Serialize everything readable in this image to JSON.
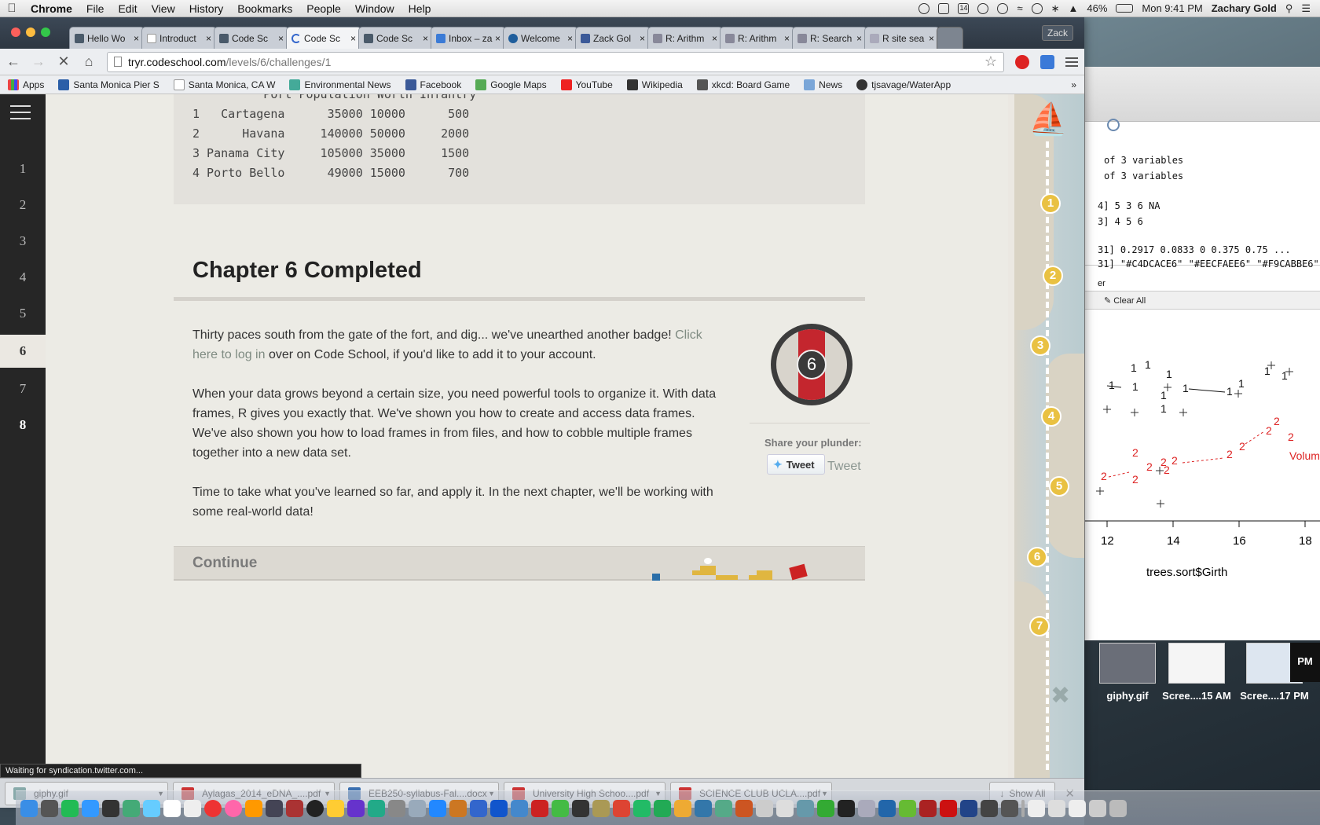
{
  "menubar": {
    "app": "Chrome",
    "items": [
      "File",
      "Edit",
      "View",
      "History",
      "Bookmarks",
      "People",
      "Window",
      "Help"
    ],
    "battery": "46%",
    "calendar_day": "14",
    "clock": "Mon 9:41 PM",
    "user": "Zachary Gold"
  },
  "browser": {
    "profile": "Zack",
    "tabs": [
      {
        "label": "Hello Wo"
      },
      {
        "label": "Introduct"
      },
      {
        "label": "Code Sc"
      },
      {
        "label": "Code Sc"
      },
      {
        "label": "Code Sc"
      },
      {
        "label": "Inbox – za"
      },
      {
        "label": "Welcome"
      },
      {
        "label": "Zack Gol"
      },
      {
        "label": "R: Arithm"
      },
      {
        "label": "R: Arithm"
      },
      {
        "label": "R: Search"
      },
      {
        "label": "R site sea"
      }
    ],
    "url_host": "tryr.codeschool.com",
    "url_path": "/levels/6/challenges/1",
    "bookmarks": [
      "Apps",
      "Santa Monica Pier S",
      "Santa Monica, CA W",
      "Environmental News",
      "Facebook",
      "Google Maps",
      "YouTube",
      "Wikipedia",
      "xkcd: Board Game",
      "News",
      "tjsavage/WaterApp"
    ]
  },
  "levels": [
    "1",
    "2",
    "3",
    "4",
    "5",
    "6",
    "7",
    "8"
  ],
  "code_output": [
    "          Port Population Worth Infantry",
    "1   Cartagena      35000 10000      500",
    "2      Havana     140000 50000     2000",
    "3 Panama City     105000 35000     1500",
    "4 Porto Bello      49000 15000      700"
  ],
  "chapter": {
    "title": "Chapter 6 Completed",
    "p1_before": "Thirty paces south from the gate of the fort, and dig... we've unearthed another badge! ",
    "p1_link": "Click here to log in",
    "p1_after": " over on Code School, if you'd like to add it to your account.",
    "p2": "When your data grows beyond a certain size, you need powerful tools to organize it. With data frames, R gives you exactly that. We've shown you how to create and access data frames. We've also shown you how to load frames in from files, and how to cobble multiple frames together into a new data set.",
    "p3": "Time to take what you've learned so far, and apply it. In the next chapter, we'll be working with some real-world data!",
    "badge_number": "6",
    "share_label": "Share your plunder:",
    "tweet_button": "Tweet",
    "tweet_text": "Tweet",
    "continue": "Continue"
  },
  "map_pins": [
    "1",
    "2",
    "3",
    "4",
    "5",
    "6",
    "7"
  ],
  "status": "Waiting for syndication.twitter.com...",
  "downloads": [
    {
      "name": "giphy.gif"
    },
    {
      "name": "Aylagas_2014_eDNA_....pdf"
    },
    {
      "name": "EEB250-syllabus-Fal....docx"
    },
    {
      "name": "University High Schoo....pdf"
    },
    {
      "name": "SCIENCE CLUB UCLA....pdf"
    }
  ],
  "show_all": "Show All",
  "rwindow": {
    "lines": [
      "of 3 variables",
      "of 3 variables",
      "4] 5 3 6 NA",
      "3] 4 5 6",
      "31] 0.2917 0.0833 0 0.375 0.75 ...",
      "31] \"#C4DCACE6\" \"#EECFAEE6\" \"#F9CABBE6\""
    ],
    "header": "er",
    "clear_all": "Clear All",
    "x_ticks": [
      "12",
      "14",
      "16",
      "18"
    ],
    "xlabel": "trees.sort$Girth",
    "legend_text": "Volum"
  },
  "desktop_files": [
    "giphy.gif",
    "Scree....15 AM",
    "Scree....17 PM"
  ],
  "pm_label": "PM",
  "colors": {
    "accent": "#e9c142",
    "badge_red": "#c4262e",
    "sidebar": "#262626"
  }
}
